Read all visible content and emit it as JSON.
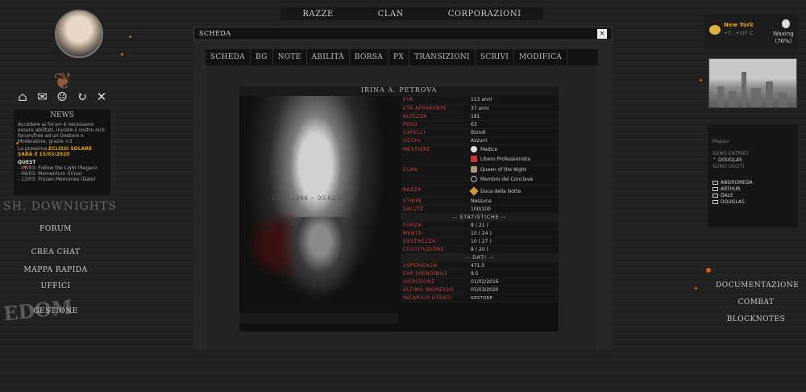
{
  "topnav": [
    "RAZZE",
    "CLAN",
    "CORPORAZIONI"
  ],
  "sidebar": {
    "news_title": "NEWS",
    "news_text": "Accedere ai forum è necessario essere abilitati, inviate il vostro nick forum/free ad un Gestore o Moderatore, grazie <3",
    "eclipse_prefix": "La prossima",
    "eclipse": "ECLISSI SOLARE",
    "eclipse_date": "SARÀ il 15/03/2020",
    "quest_title": "QUEST",
    "quests": [
      "- 07/03: Follow the Light (Regan)",
      "- 09/03: Momentum (Irina)",
      "- 13/03: Frozen Memories (Dale)"
    ],
    "brand": "SH. DOWNIGHTS",
    "bg_text": "EDOM",
    "nav": [
      "FORUM",
      "CREA CHAT",
      "MAPPA RAPIDA",
      "UFFICI",
      "GESTIONE"
    ]
  },
  "window": {
    "title": "SCHEDA",
    "close": "×",
    "tabs": [
      "SCHEDA",
      "BG",
      "NOTE",
      "ABILITÀ",
      "BORSA",
      "PX",
      "TRANSIZIONI",
      "SCRIVI",
      "MODIFICA"
    ]
  },
  "sheet": {
    "name": "IRINA A. PETROVA",
    "dates": "15.02.1984 ~ 05.02.2020",
    "rows": [
      {
        "k": "ETÀ",
        "v": "113 anni"
      },
      {
        "k": "ETÀ APPARENTE",
        "v": "37 anni"
      },
      {
        "k": "ALTEZZA",
        "v": "181"
      },
      {
        "k": "PESO",
        "v": "63"
      },
      {
        "k": "CAPELLI",
        "v": "Biondi"
      },
      {
        "k": "OCCHI",
        "v": "Azzurri"
      }
    ],
    "mestiere_label": "MESTIERE",
    "mestiere": [
      "Medico",
      "Libero Professionista"
    ],
    "clan_label": "CLAN",
    "clan": [
      "Queen of the Night",
      "Membro del Conclave"
    ],
    "razza_label": "RAZZA",
    "razza": "Duca della Notte",
    "rows2": [
      {
        "k": "STIRPE",
        "v": "Nessuna"
      },
      {
        "k": "SALUTE",
        "v": "100/100"
      }
    ],
    "stat_title": "-- STATISTICHE --",
    "stats": [
      {
        "k": "FORZA:",
        "v": "8 ( 21 )"
      },
      {
        "k": "MENTE:",
        "v": "10 ( 24 )"
      },
      {
        "k": "DESTREZZA:",
        "v": "10 ( 27 )"
      },
      {
        "k": "COSTITUZIONE:",
        "v": "8 ( 20 )"
      }
    ],
    "data_title": "-- DATI --",
    "dati": [
      {
        "k": "ESPERIENZA",
        "v": "471.5"
      },
      {
        "k": "EXP SPENDIBILE",
        "v": "9.5"
      },
      {
        "k": "ISCRIZIONE",
        "v": "01/02/2016"
      },
      {
        "k": "ULTIMO INGRESSO",
        "v": "05/03/2020"
      }
    ],
    "incarico_label": "INCARICO UTENTI",
    "incarico": "GESTORE"
  },
  "weather": {
    "city": "New York",
    "temp": "+7...+10° C",
    "moon": "Waxing",
    "moon_pct": "(76%)"
  },
  "map": {
    "title": "Mappa",
    "entered_label": "SONO ENTRATI",
    "entered": [
      "DOUGLAS"
    ],
    "left_label": "SONO USCITI",
    "users": [
      "ANDROMEDA",
      "ARTHUR",
      "DALE",
      "DOUGLAS"
    ]
  },
  "right_nav": [
    "DOCUMENTAZIONE",
    "COMBAT",
    "BLOCKNOTES"
  ]
}
